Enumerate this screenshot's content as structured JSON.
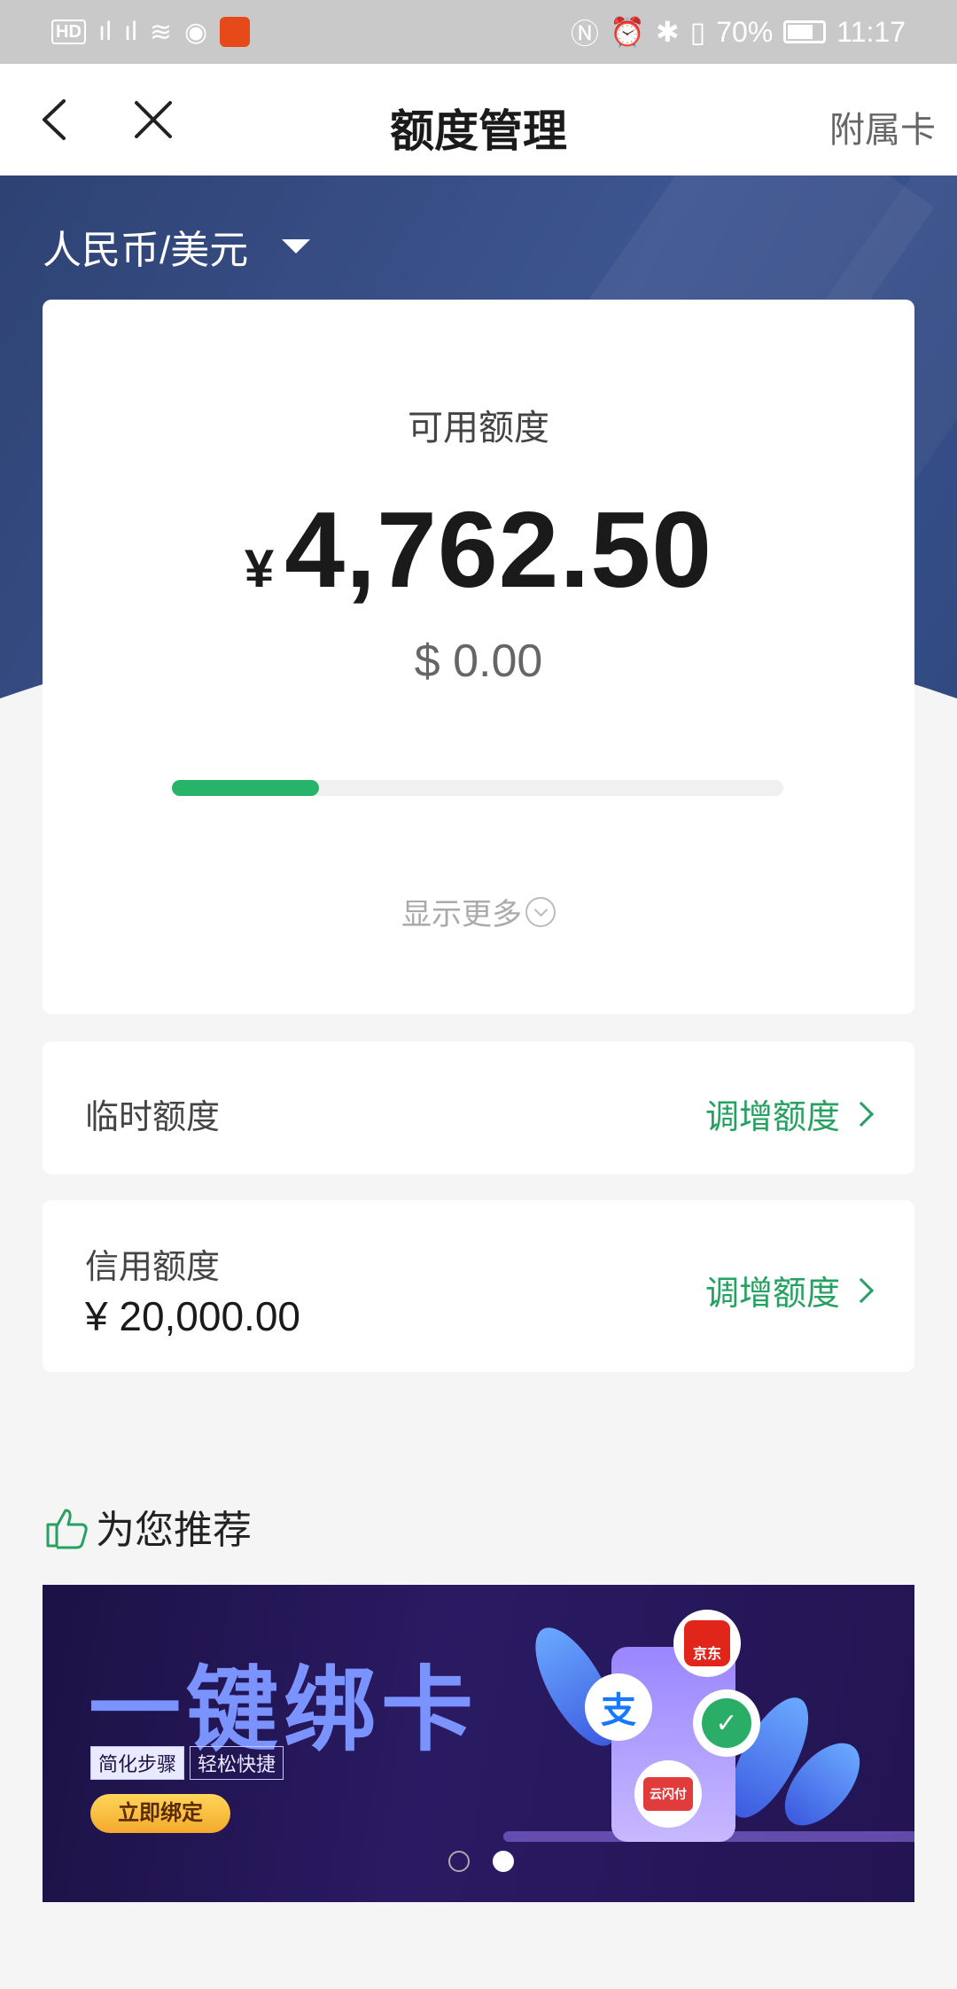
{
  "status_bar": {
    "network": [
      "HD",
      "4G",
      "2G"
    ],
    "app_badge": "",
    "battery": "70%",
    "time": "11:17"
  },
  "nav": {
    "title": "额度管理",
    "right_link": "附属卡",
    "back_icon": "chevron-left-icon",
    "close_icon": "close-icon"
  },
  "currency_selector": "人民币/美元",
  "available": {
    "label": "可用额度",
    "yen_symbol": "¥",
    "amount": "4,762.50",
    "usd": "$ 0.00",
    "usage_fraction": 0.24,
    "more_label": "显示更多"
  },
  "temp_limit": {
    "label": "临时额度",
    "action": "调增额度"
  },
  "credit_limit": {
    "label": "信用额度",
    "value": "¥ 20,000.00",
    "action": "调增额度"
  },
  "recommend": {
    "title": "为您推荐",
    "banner": {
      "title": "一键绑卡",
      "tags": [
        "简化步骤",
        "轻松快捷"
      ],
      "button": "立即绑定",
      "pay_icons": [
        "京东",
        "支",
        "云闪付"
      ],
      "dot_count": 2,
      "active_dot": 1
    }
  },
  "colors": {
    "header_blue": "#3d5590",
    "accent_green": "#27a162",
    "progress_green": "#27b46a"
  }
}
